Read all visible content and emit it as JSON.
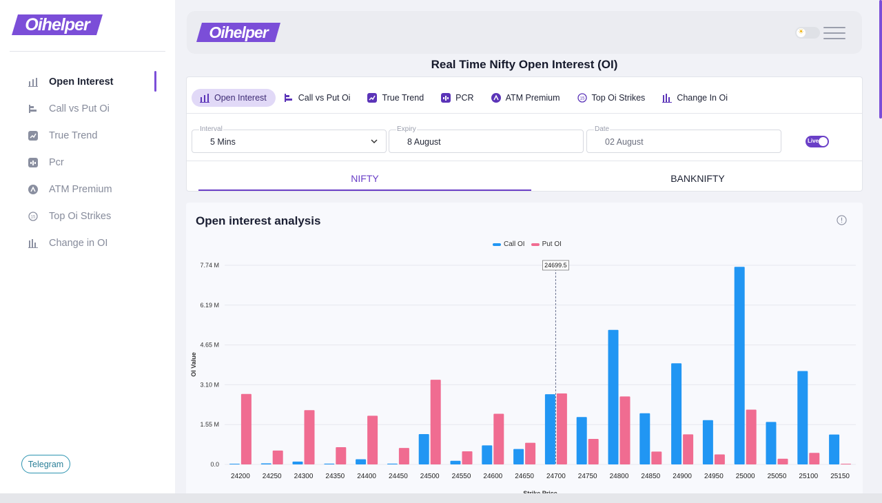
{
  "brand": {
    "name": "Oihelper",
    "color": "#7b4ed8"
  },
  "sidebar": {
    "items": [
      {
        "label": "Open Interest",
        "icon": "bar-chart-icon",
        "active": true
      },
      {
        "label": "Call vs Put Oi",
        "icon": "horizontal-bar-icon"
      },
      {
        "label": "True Trend",
        "icon": "trend-icon"
      },
      {
        "label": "Pcr",
        "icon": "pcr-icon"
      },
      {
        "label": "ATM Premium",
        "icon": "atm-icon"
      },
      {
        "label": "Top Oi Strikes",
        "icon": "top-strikes-icon"
      },
      {
        "label": "Change in OI",
        "icon": "change-oi-icon"
      }
    ],
    "telegram_label": "Telegram"
  },
  "header": {
    "theme_icon": "sun-icon",
    "menu_icon": "hamburger-icon"
  },
  "page_title": "Real Time Nifty Open Interest (OI)",
  "tabs": [
    {
      "label": "Open Interest",
      "icon": "bar-chart-icon",
      "active": true
    },
    {
      "label": "Call vs Put Oi",
      "icon": "horizontal-bar-icon"
    },
    {
      "label": "True Trend",
      "icon": "trend-icon"
    },
    {
      "label": "PCR",
      "icon": "pcr-icon"
    },
    {
      "label": "ATM Premium",
      "icon": "atm-icon"
    },
    {
      "label": "Top Oi Strikes",
      "icon": "top-strikes-icon"
    },
    {
      "label": "Change In Oi",
      "icon": "change-oi-icon"
    }
  ],
  "filters": {
    "interval": {
      "label": "Interval",
      "value": "5 Mins"
    },
    "expiry": {
      "label": "Expiry",
      "value": "8 August"
    },
    "date": {
      "label": "Date",
      "value": "02 August"
    },
    "live_label": "Live"
  },
  "market_tabs": [
    {
      "label": "NIFTY",
      "active": true
    },
    {
      "label": "BANKNIFTY"
    }
  ],
  "analysis": {
    "title": "Open interest analysis",
    "info_icon": "info-icon"
  },
  "colors": {
    "call": "#2196f3",
    "put": "#f06c91"
  },
  "chart_data": {
    "type": "bar",
    "xlabel": "Strike Price",
    "ylabel": "OI Value",
    "ylim": [
      0,
      7740000
    ],
    "yticks": [
      "0.0",
      "1.55 M",
      "3.10 M",
      "4.65 M",
      "6.19 M",
      "7.74 M"
    ],
    "grid": true,
    "legend": "top-center",
    "crosshair_label": "24699.5",
    "categories": [
      "24200",
      "24250",
      "24300",
      "24350",
      "24400",
      "24450",
      "24500",
      "24550",
      "24600",
      "24650",
      "24700",
      "24750",
      "24800",
      "24850",
      "24900",
      "24950",
      "25000",
      "25050",
      "25100",
      "25150"
    ],
    "series": [
      {
        "name": "Call OI",
        "color": "#2196f3",
        "values": [
          20000,
          40000,
          110000,
          30000,
          200000,
          30000,
          1180000,
          140000,
          740000,
          600000,
          2730000,
          1840000,
          5230000,
          1990000,
          3930000,
          1720000,
          7680000,
          1650000,
          3630000,
          1160000
        ]
      },
      {
        "name": "Put OI",
        "color": "#f06c91",
        "values": [
          2740000,
          540000,
          2110000,
          670000,
          1890000,
          640000,
          3290000,
          510000,
          1970000,
          840000,
          2760000,
          990000,
          2640000,
          500000,
          1170000,
          390000,
          2130000,
          220000,
          450000,
          20000
        ]
      }
    ]
  }
}
